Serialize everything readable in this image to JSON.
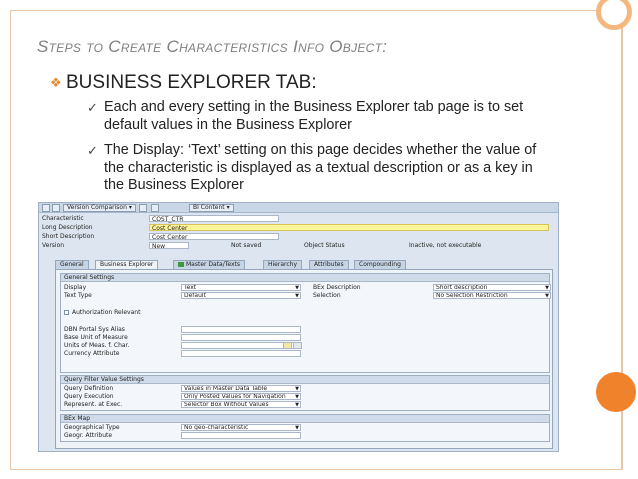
{
  "slide": {
    "title": "Steps to Create Characteristics Info Object:",
    "bullet": "BUSINESS EXPLORER TAB:",
    "sub_bullets": [
      "Each and every setting in the Business Explorer tab page is to set default values in the Business Explorer",
      "The Display: ‘Text’ setting on this page decides whether the value of the characteristic is displayed as a textual description or as a key in the Business Explorer"
    ],
    "accent_color": "#f0822c"
  },
  "sap": {
    "toolbar": {
      "version_comparison": "Version Comparison",
      "bi_content": "BI Content"
    },
    "header": {
      "characteristic_label": "Characteristic",
      "characteristic_value": "COST_CTR",
      "long_desc_label": "Long Description",
      "long_desc_value": "Cost Center",
      "short_desc_label": "Short Description",
      "short_desc_value": "Cost Center",
      "version_label": "Version",
      "version_value": "New",
      "version_status": "Not saved",
      "object_status_label": "Object Status",
      "object_status_value": "Inactive, not executable"
    },
    "tabs": [
      "General",
      "Business Explorer",
      "Master Data/Texts",
      "Hierarchy",
      "Attributes",
      "Compounding"
    ],
    "general_settings": {
      "title": "General Settings",
      "display_label": "Display",
      "display_value": "Text",
      "text_type_label": "Text Type",
      "text_type_value": "Default",
      "bex_desc_label": "BEx Description",
      "bex_desc_value": "Short description",
      "selection_label": "Selection",
      "selection_value": "No Selection Restriction",
      "auth_relevant_label": "Authorization Relevant",
      "dbn_portal_label": "DBN Portal Sys Alias",
      "base_uom_label": "Base Unit of Measure",
      "units_meas_label": "Units of Meas. f. Char.",
      "currency_attr_label": "Currency Attribute"
    },
    "query_filter": {
      "title": "Query Filter Value Settings",
      "query_def_label": "Query Definition",
      "query_def_value": "Values in Master Data Table",
      "query_exec_label": "Query Execution",
      "query_exec_value": "Only Posted Values for Navigation",
      "represent_label": "Represent. at Exec.",
      "represent_value": "Selector Box Without Values"
    },
    "bex_map": {
      "title": "BEx Map",
      "geo_type_label": "Geographical Type",
      "geo_type_value": "No geo-characteristic",
      "geo_attr_label": "Geogr. Attribute"
    }
  }
}
